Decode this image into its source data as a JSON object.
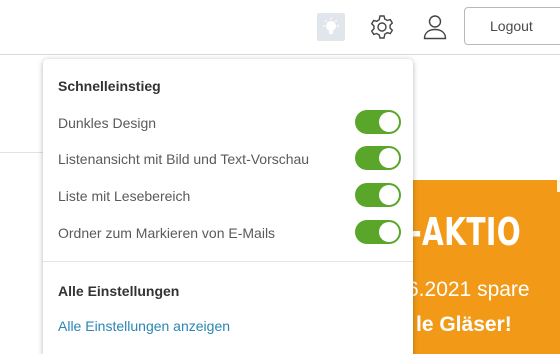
{
  "header": {
    "logout_label": "Logout",
    "icons": {
      "tip": "lightbulb-icon",
      "settings": "gear-icon",
      "account": "user-icon"
    }
  },
  "promo": {
    "headline": "-AKTIO",
    "line1": "6.2021 spare",
    "line2": "le Gläser!",
    "color": "#f29a17"
  },
  "quick_settings": {
    "title": "Schnelleinstieg",
    "options": [
      {
        "label": "Dunkles Design",
        "enabled": true
      },
      {
        "label": "Listenansicht mit Bild und Text-Vorschau",
        "enabled": true
      },
      {
        "label": "Liste mit Lesebereich",
        "enabled": true
      },
      {
        "label": "Ordner zum Markieren von E-Mails",
        "enabled": true
      }
    ],
    "toggle_color": "#59a62a"
  },
  "all_settings": {
    "title": "Alle Einstellungen",
    "link_label": "Alle Einstellungen anzeigen",
    "link_color": "#2a86b5"
  }
}
